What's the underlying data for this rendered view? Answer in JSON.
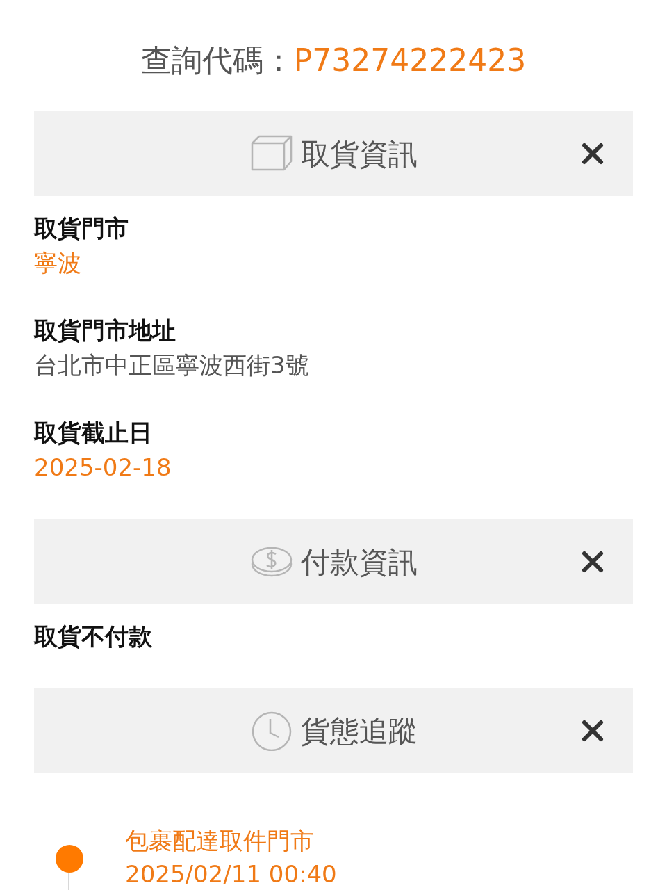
{
  "query": {
    "label": "查詢代碼：",
    "code": "P73274222423"
  },
  "sections": [
    {
      "title": "取貨資訊",
      "fields": [
        {
          "label": "取貨門市",
          "value": "寧波",
          "highlight": true
        },
        {
          "label": "取貨門市地址",
          "value": "台北市中正區寧波西街3號",
          "highlight": false
        },
        {
          "label": "取貨截止日",
          "value": "2025-02-18",
          "highlight": true
        }
      ]
    },
    {
      "title": "付款資訊",
      "fields": [
        {
          "label": "取貨不付款"
        }
      ]
    },
    {
      "title": "貨態追蹤",
      "timeline": [
        {
          "title": "包裹配達取件門市",
          "time": "2025/02/11 00:40",
          "current": true
        }
      ]
    }
  ]
}
